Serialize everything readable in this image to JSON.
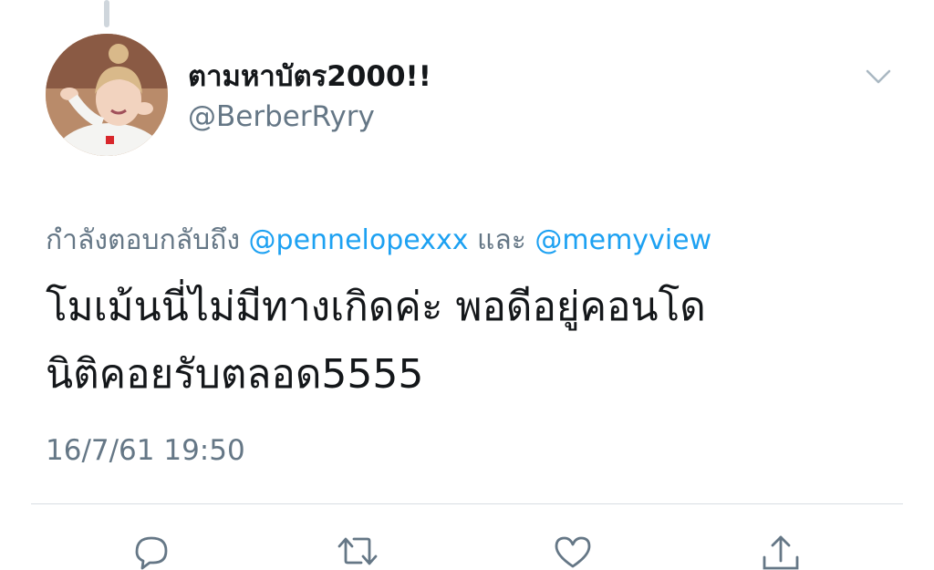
{
  "tweet": {
    "author": {
      "display_name": "ตามหาบัตร2000!!",
      "handle": "@BerberRyry"
    },
    "reply_context": {
      "prefix": "กำลังตอบกลับถึง",
      "mention_1": "@pennelopexxx",
      "conjunction": "และ",
      "mention_2": "@memyview"
    },
    "text_lines": [
      "โมเม้นนี่ไม่มีทางเกิดค่ะ พอดีอยู่คอนโด",
      "นิติคอยรับตลอด5555"
    ],
    "timestamp": "16/7/61 19:50"
  },
  "icons": {
    "menu": "chevron-down-icon",
    "reply": "reply-icon",
    "retweet": "retweet-icon",
    "like": "heart-icon",
    "share": "share-icon"
  },
  "colors": {
    "text_primary": "#14171a",
    "text_secondary": "#657786",
    "link": "#1da1f2",
    "divider": "#d8dee3"
  }
}
